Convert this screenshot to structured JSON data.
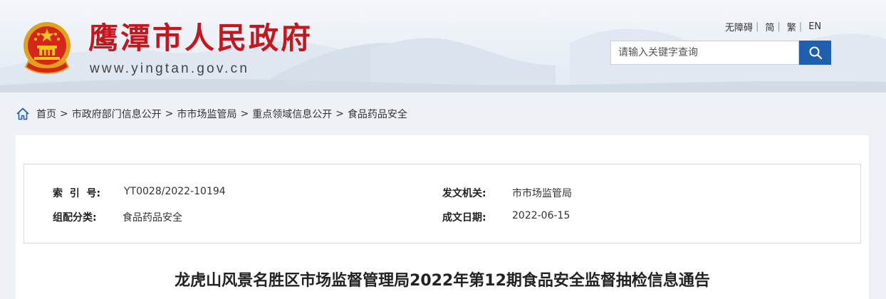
{
  "site": {
    "title": "鹰潭市人民政府",
    "url": "www.yingtan.gov.cn",
    "brand_color": "#c4161c",
    "emblem_icon": "national-emblem-icon"
  },
  "top_links": [
    {
      "label": "无障碍"
    },
    {
      "label": "简"
    },
    {
      "label": "繁"
    },
    {
      "label": "EN"
    }
  ],
  "search": {
    "placeholder": "请输入关键字查询",
    "button_icon": "search-icon",
    "button_color": "#1e5fae"
  },
  "breadcrumb": {
    "home_icon": "home-icon",
    "items": [
      "首页",
      "市政府部门信息公开",
      "市市场监管局",
      "重点领域信息公开",
      "食品药品安全"
    ],
    "separator": ">"
  },
  "info": {
    "index_label": "索  引  号:",
    "index_value": "YT0028/2022-10194",
    "issuer_label": "发文机关:",
    "issuer_value": "市市场监管局",
    "category_label": "组配分类:",
    "category_value": "食品药品安全",
    "date_label": "成文日期:",
    "date_value": "2022-06-15"
  },
  "article": {
    "title": "龙虎山风景名胜区市场监督管理局2022年第12期食品安全监督抽检信息通告"
  }
}
